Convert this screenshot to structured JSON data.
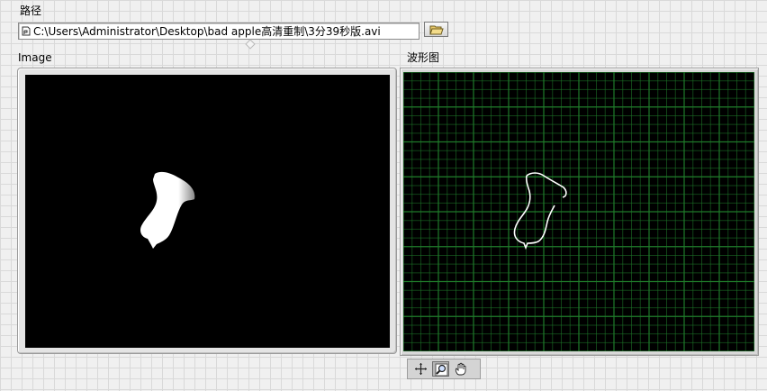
{
  "path_control": {
    "label": "路径",
    "value": "C:\\Users\\Administrator\\Desktop\\bad apple高清重制\\3分39秒版.avi"
  },
  "image_display": {
    "label": "Image"
  },
  "waveform_graph": {
    "label": "波形图",
    "background_color": "#000000",
    "grid_color": "#1f7a2a",
    "plot_color": "#ffffff"
  },
  "graph_palette": {
    "tools": [
      "cursor-move-icon",
      "zoom-icon",
      "pan-hand-icon"
    ],
    "selected_tool": "zoom-icon"
  }
}
